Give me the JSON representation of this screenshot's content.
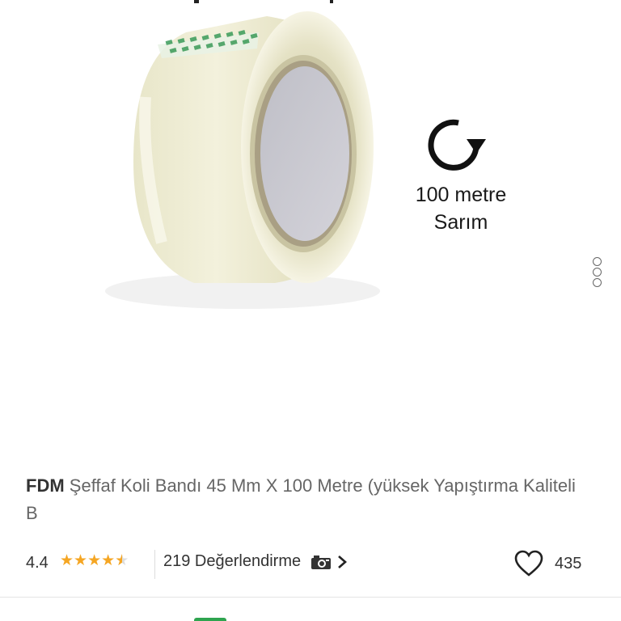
{
  "product_image": {
    "spec_length": "100 metre",
    "spec_label": "Sarım",
    "alt": "Şeffaf koli bandı"
  },
  "product": {
    "brand": "FDM",
    "title": "Şeffaf Koli Bandı 45 Mm X 100 Metre (yüksek Yapıştırma Kaliteli B"
  },
  "rating": {
    "value": "4.4",
    "stars": 4.5,
    "reviews_label": "219 Değerlendirme"
  },
  "favorites": {
    "count": "435"
  },
  "colors": {
    "star": "#f5a623",
    "accent": "#2ea44f",
    "text": "#333333"
  },
  "icons": {
    "rotation": "rotate-clockwise-icon",
    "camera": "camera-icon",
    "chevron": "chevron-right-icon",
    "heart": "heart-icon",
    "more": "more-dots-icon"
  }
}
